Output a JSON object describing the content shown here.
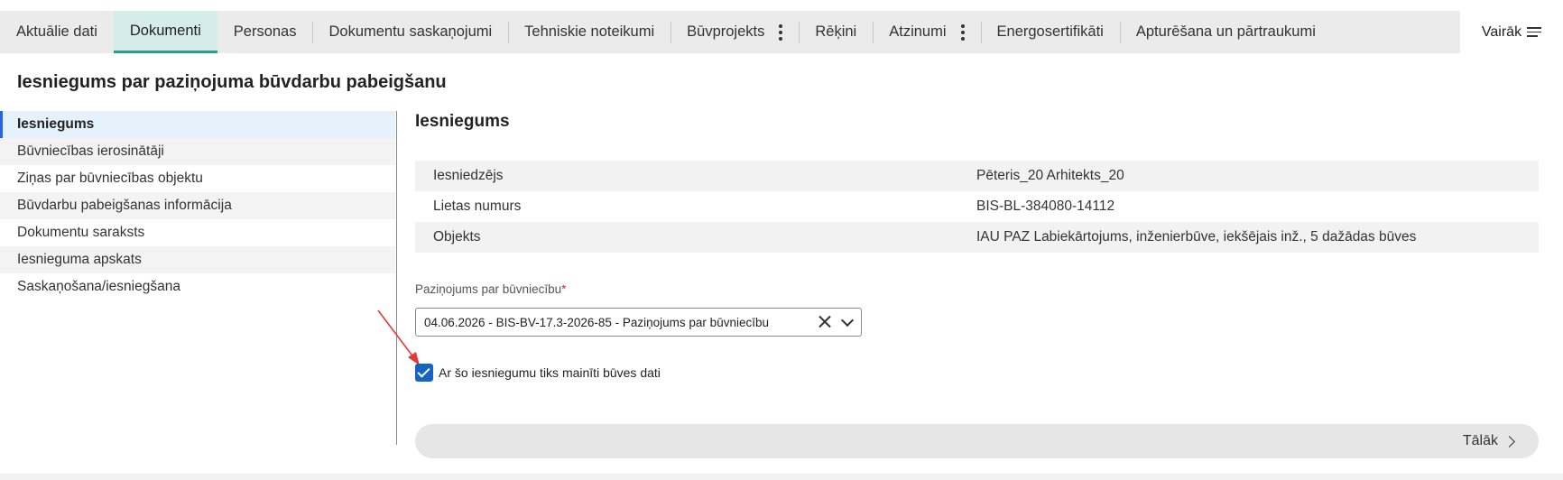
{
  "tabs": [
    {
      "label": "Aktuālie dati",
      "active": false,
      "menu": false
    },
    {
      "label": "Dokumenti",
      "active": true,
      "menu": false
    },
    {
      "label": "Personas",
      "active": false,
      "menu": false
    },
    {
      "label": "Dokumentu saskaņojumi",
      "active": false,
      "menu": false
    },
    {
      "label": "Tehniskie noteikumi",
      "active": false,
      "menu": false
    },
    {
      "label": "Būvprojekts",
      "active": false,
      "menu": true
    },
    {
      "label": "Rēķini",
      "active": false,
      "menu": false
    },
    {
      "label": "Atzinumi",
      "active": false,
      "menu": true
    },
    {
      "label": "Energosertifikāti",
      "active": false,
      "menu": false
    },
    {
      "label": "Apturēšana un pārtraukumi",
      "active": false,
      "menu": false
    }
  ],
  "more_label": "Vairāk",
  "page_title": "Iesniegums par paziņojuma būvdarbu pabeigšanu",
  "sidebar": {
    "items": [
      {
        "label": "Iesniegums",
        "active": true
      },
      {
        "label": "Būvniecības ierosinātāji",
        "active": false
      },
      {
        "label": "Ziņas par būvniecības objektu",
        "active": false
      },
      {
        "label": "Būvdarbu pabeigšanas informācija",
        "active": false
      },
      {
        "label": "Dokumentu saraksts",
        "active": false
      },
      {
        "label": "Iesnieguma apskats",
        "active": false
      },
      {
        "label": "Saskaņošana/iesniegšana",
        "active": false
      }
    ]
  },
  "main": {
    "section_title": "Iesniegums",
    "info_rows": [
      {
        "label": "Iesniedzējs",
        "value": "Pēteris_20 Arhitekts_20"
      },
      {
        "label": "Lietas numurs",
        "value": "BIS-BL-384080-14112"
      },
      {
        "label": "Objekts",
        "value": "IAU PAZ Labiekārtojums, inženierbūve, iekšējais inž., 5 dažādas būves"
      }
    ],
    "field_label": "Paziņojums par būvniecību",
    "required_mark": "*",
    "select_value": "04.06.2026 - BIS-BV-17.3-2026-85 - Paziņojums par būvniecību",
    "checkbox_label": "Ar šo iesniegumu tiks mainīti būves dati",
    "checkbox_checked": true,
    "next_label": "Tālāk"
  },
  "colors": {
    "active_tab_bg": "#d5ecea",
    "active_tab_border": "#2a9d8f",
    "checkbox": "#1565c0",
    "required": "#d62828",
    "annotation_arrow": "#e53935"
  },
  "icons": [
    "kebab-menu-icon",
    "hamburger-menu-icon",
    "clear-icon",
    "chevron-down-icon",
    "checkmark-icon",
    "chevron-right-icon",
    "annotation-arrow-icon"
  ]
}
